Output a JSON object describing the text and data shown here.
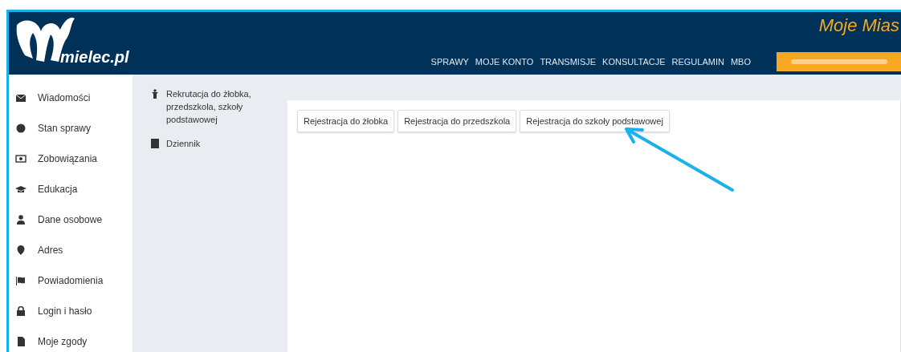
{
  "header": {
    "logo": "mielec.pl",
    "city_title": "Moje Mias",
    "nav": [
      "SPRAWY",
      "MOJE KONTO",
      "TRANSMISJE",
      "KONSULTACJE",
      "REGULAMIN",
      "MBO"
    ]
  },
  "sidebar": {
    "items": [
      "Wiadomości",
      "Stan sprawy",
      "Zobowiązania",
      "Edukacja",
      "Dane osobowe",
      "Adres",
      "Powiadomienia",
      "Login i hasło",
      "Moje zgody"
    ]
  },
  "submenu": {
    "items": [
      "Rekrutacja do żłobka, przedszkola, szkoły podstawowej",
      "Dziennik"
    ]
  },
  "tabs": [
    "Rejestracja do żłobka",
    "Rejestracja do przedszkola",
    "Rejestracja do szkoły podstawowej"
  ]
}
